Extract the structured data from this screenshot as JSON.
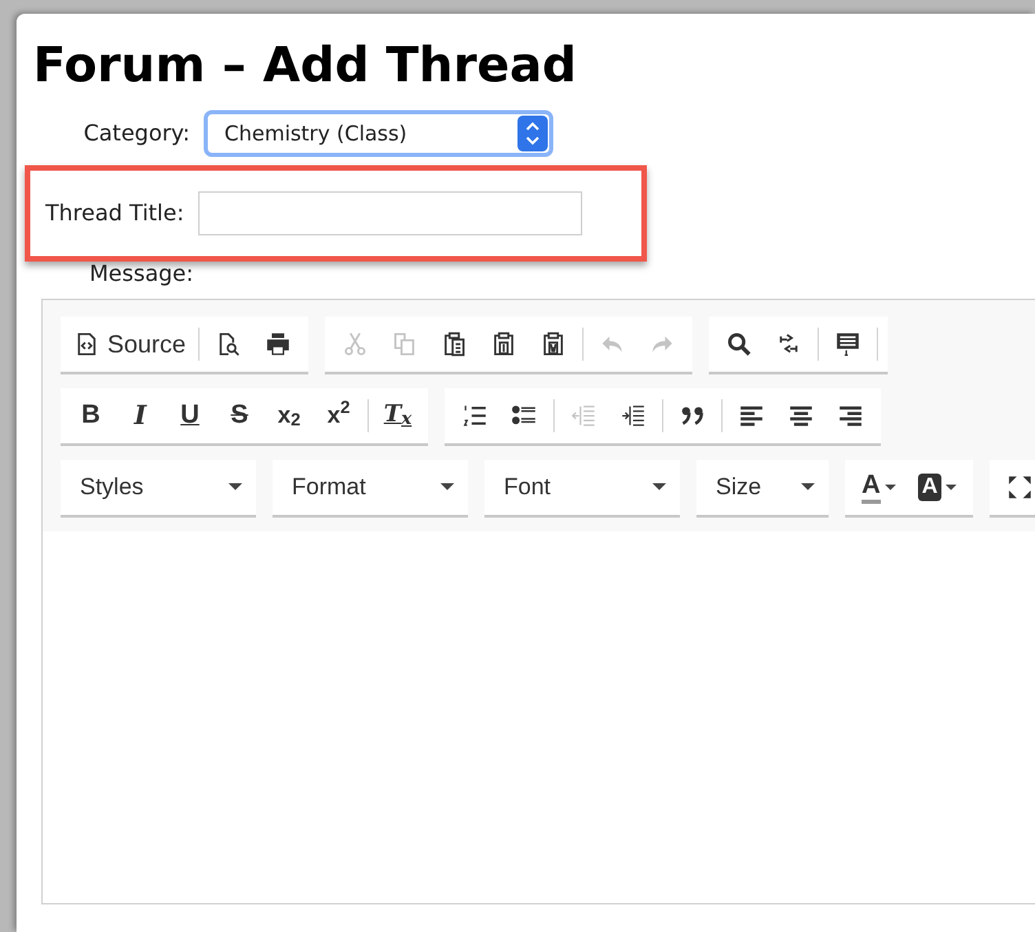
{
  "page": {
    "title": "Forum – Add Thread"
  },
  "form": {
    "category_label": "Category:",
    "category_value": "Chemistry (Class)",
    "thread_title_label": "Thread Title:",
    "message_label": "Message:"
  },
  "toolbar_rows": [
    [
      [
        {
          "kind": "source",
          "label": "Source",
          "disabled": false
        },
        {
          "kind": "separator"
        },
        {
          "kind": "preview",
          "disabled": false
        },
        {
          "kind": "print",
          "disabled": false
        }
      ],
      [
        {
          "kind": "cut",
          "disabled": true
        },
        {
          "kind": "copy",
          "disabled": true
        },
        {
          "kind": "paste",
          "disabled": false
        },
        {
          "kind": "paste-text",
          "disabled": false
        },
        {
          "kind": "paste-word",
          "disabled": false
        },
        {
          "kind": "separator"
        },
        {
          "kind": "undo",
          "disabled": true
        },
        {
          "kind": "redo",
          "disabled": true
        }
      ],
      [
        {
          "kind": "find",
          "disabled": false
        },
        {
          "kind": "replace",
          "disabled": false
        },
        {
          "kind": "separator"
        },
        {
          "kind": "form",
          "disabled": false
        },
        {
          "kind": "separator"
        }
      ]
    ],
    [
      [
        {
          "kind": "bold",
          "label": "B",
          "disabled": false
        },
        {
          "kind": "italic",
          "label": "I",
          "disabled": false
        },
        {
          "kind": "underline",
          "label": "U",
          "disabled": false
        },
        {
          "kind": "strike",
          "label": "S",
          "disabled": false
        },
        {
          "kind": "script",
          "label": "x$_{2}$",
          "disabled": false
        },
        {
          "kind": "script",
          "label": "x$^{2}$",
          "disabled": false
        },
        {
          "kind": "separator"
        },
        {
          "kind": "clear",
          "label": "T$_{x}$",
          "disabled": false
        }
      ],
      [
        {
          "kind": "numbered-list",
          "disabled": false
        },
        {
          "kind": "bullet-list",
          "disabled": false
        },
        {
          "kind": "separator"
        },
        {
          "kind": "outdent",
          "disabled": true
        },
        {
          "kind": "indent",
          "disabled": false
        },
        {
          "kind": "separator"
        },
        {
          "kind": "quote",
          "disabled": false
        },
        {
          "kind": "separator"
        },
        {
          "kind": "align-left",
          "disabled": false
        },
        {
          "kind": "align-center",
          "disabled": false
        },
        {
          "kind": "align-right",
          "disabled": false
        }
      ]
    ],
    [
      [
        {
          "kind": "combo",
          "label": "Styles"
        }
      ],
      [
        {
          "kind": "combo",
          "label": "Format"
        }
      ],
      [
        {
          "kind": "combo",
          "label": "Font"
        }
      ],
      [
        {
          "kind": "combo",
          "label": "Size",
          "narrow": true
        }
      ],
      [
        {
          "kind": "text-color",
          "label": "A"
        },
        {
          "kind": "bg-color",
          "label": "A"
        }
      ],
      [
        {
          "kind": "maximize",
          "disabled": false
        }
      ]
    ]
  ]
}
